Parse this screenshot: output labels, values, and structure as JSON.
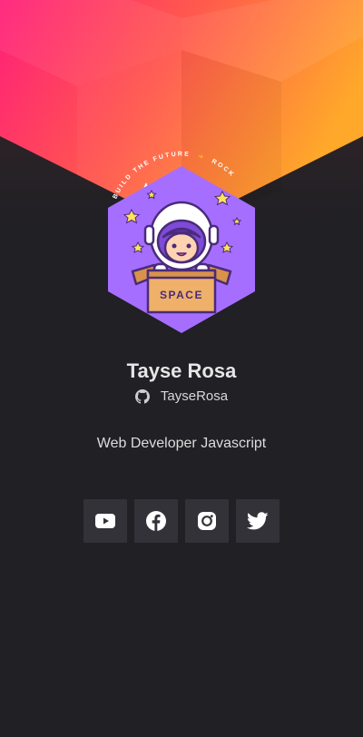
{
  "theme": {
    "background": "#202025",
    "gradient_start": "#ff2d78",
    "gradient_end": "#ffa62b",
    "avatar_bg": "#a66eff",
    "button_bg": "#323238",
    "text_color": "#e6e6e6"
  },
  "avatar": {
    "curved_text": "BUILD THE FUTURE",
    "arrow": "➔",
    "rocket_text": "ROCK",
    "box_label": "SPACE",
    "icon": "astronaut-in-box-illustration"
  },
  "profile": {
    "name": "Tayse Rosa",
    "github_username": "TayseRosa",
    "github_icon": "github-icon",
    "bio": "Web Developer Javascript"
  },
  "social": [
    {
      "name": "youtube",
      "icon": "youtube-icon"
    },
    {
      "name": "facebook",
      "icon": "facebook-icon"
    },
    {
      "name": "instagram",
      "icon": "instagram-icon"
    },
    {
      "name": "twitter",
      "icon": "twitter-icon"
    }
  ]
}
